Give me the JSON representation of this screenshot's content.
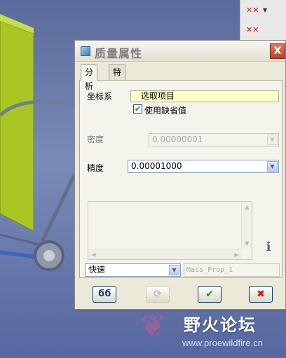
{
  "dialog": {
    "title": "质量属性",
    "close_label": "X"
  },
  "tabs": [
    {
      "label": "分析",
      "active": true
    },
    {
      "label": "特征",
      "active": false
    }
  ],
  "analysis": {
    "coord_system_label": "坐标系",
    "select_item": "选取项目",
    "use_default_label": "使用缺省值",
    "use_default_checked": true,
    "density_label": "密度",
    "density_value": "0.00000001",
    "precision_label": "精度",
    "precision_value": "0.00001000"
  },
  "bottom": {
    "mode_value": "快速",
    "mass_prop_name": "Mass_Prop_1"
  },
  "icons": {
    "info": "i",
    "check": "✔",
    "cancel": "✖",
    "glasses": "ϭϭ",
    "refresh": "⟳",
    "dropdown": "▼"
  },
  "watermark": {
    "title": "野火论坛",
    "url": "www.proewildfire.cn"
  },
  "colors": {
    "selector_bg": "#ffffc8",
    "ok_green": "#1d8d1d",
    "cancel_red": "#c81a1a",
    "model_green": "#a9c622"
  }
}
